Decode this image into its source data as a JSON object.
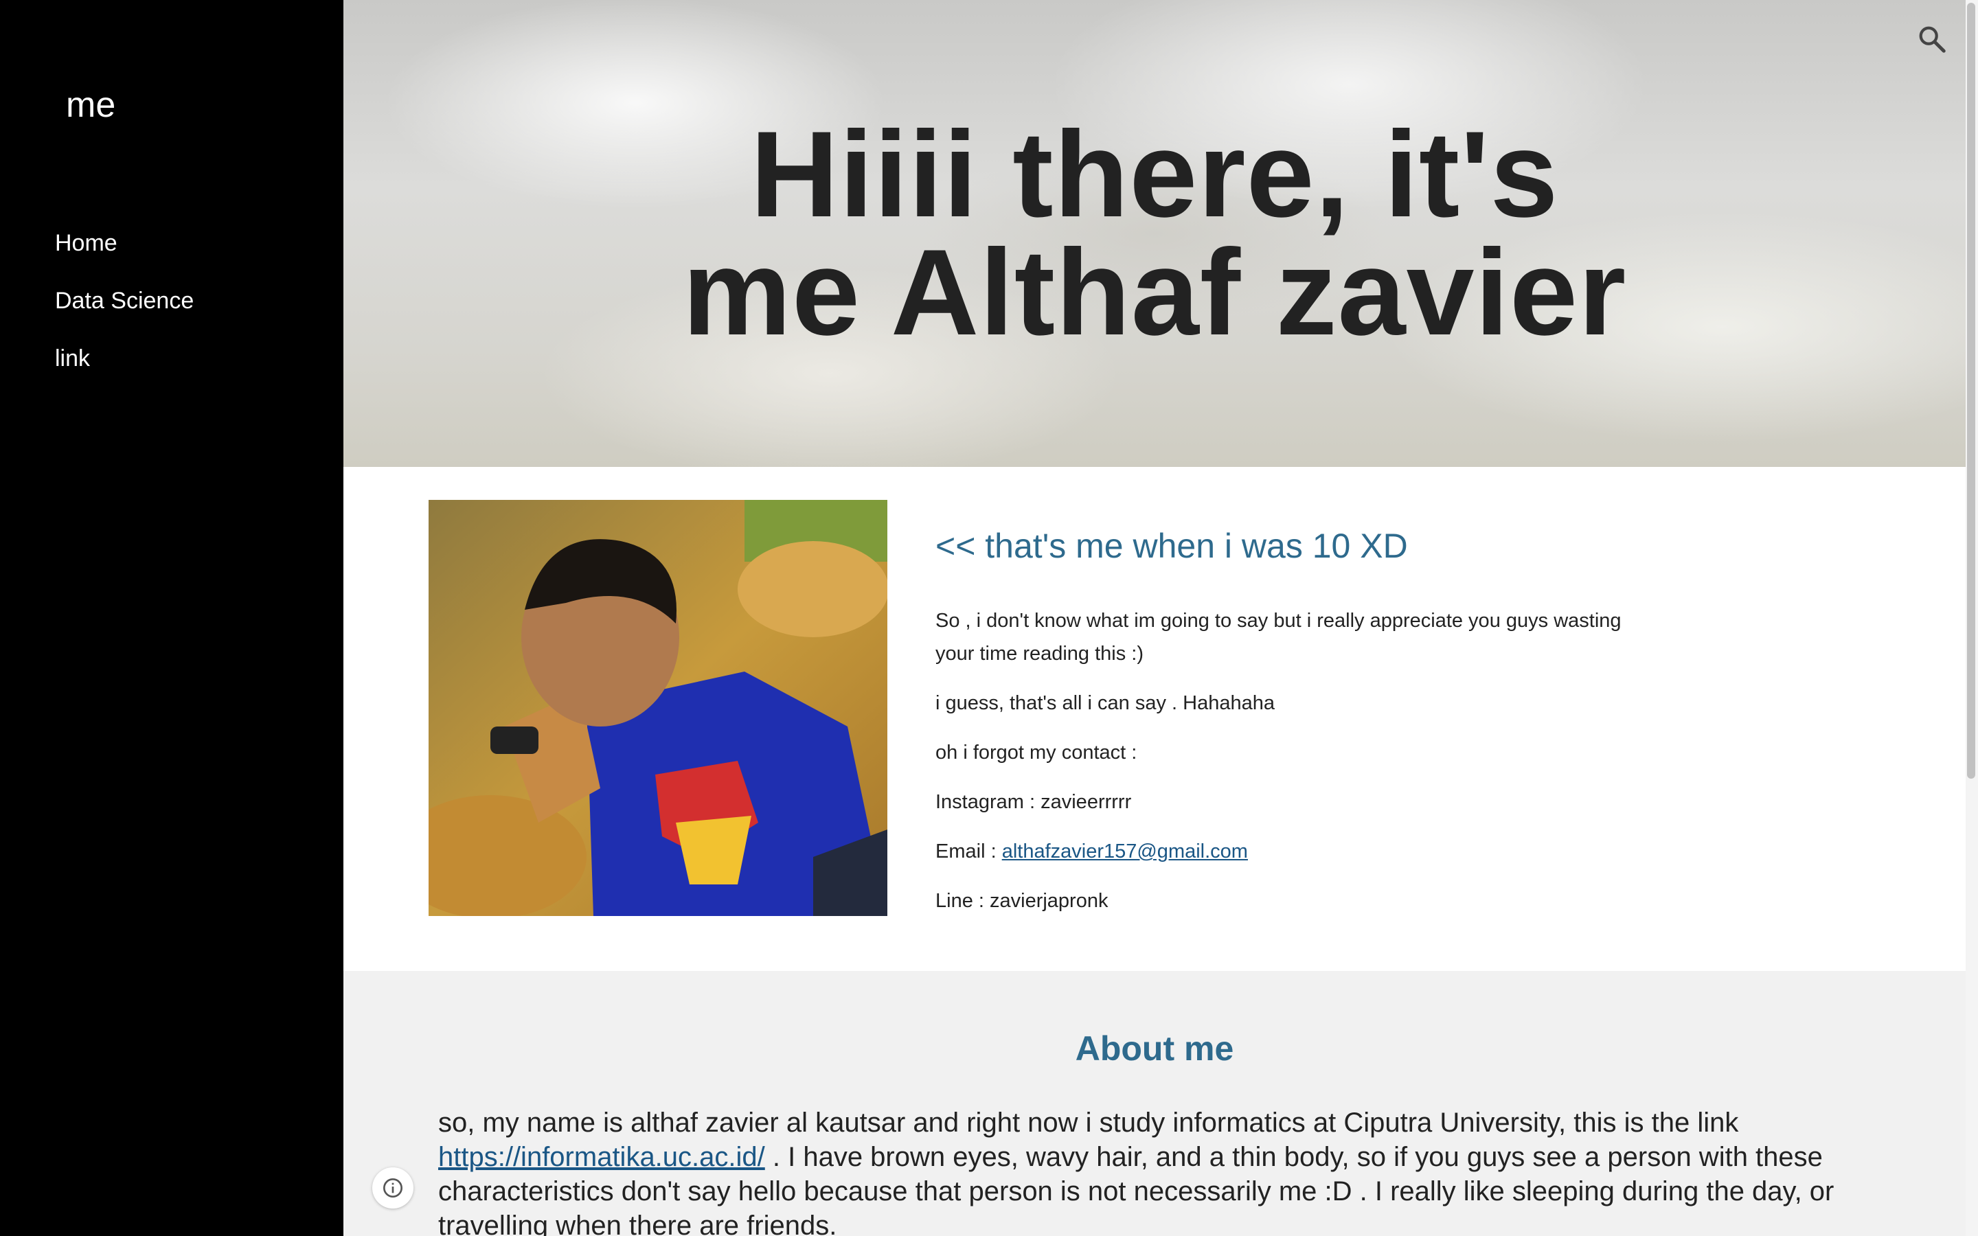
{
  "sidebar": {
    "site_title": "me",
    "nav": [
      "Home",
      "Data Science",
      "link"
    ]
  },
  "hero": {
    "title_line1": "Hiiii there, it's",
    "title_line2": "me Althaf zavier",
    "search_icon": "search-icon"
  },
  "intro": {
    "photo_icon": "photo-of-boy",
    "caption": "<< that's me when i was 10 XD",
    "paragraphs": [
      "So , i don't know what im going to say but i really appreciate you guys wasting your time reading this :)",
      "i guess, that's all i can say . Hahahaha",
      "oh i forgot my contact :",
      "Instagram : zavieerrrrr"
    ],
    "email_label": "Email : ",
    "email_link": "althafzavier157@gmail.com",
    "line_text": "Line : zavierjapronk"
  },
  "about": {
    "heading": "About me",
    "text_before_link": "so, my name is althaf zavier al kautsar and right now i study informatics at Ciputra University, this is the link ",
    "link": "https://informatika.uc.ac.id/",
    "text_after_link": " . I have brown eyes, wavy hair, and a thin body, so if you guys see a person with these characteristics don't say hello because that person is not necessarily me :D . I really like sleeping during the day, or travelling when there are friends."
  },
  "colors": {
    "sidebar_bg": "#000000",
    "accent": "#2e6a8d",
    "link": "#1a5685",
    "about_bg": "#f1f1f1"
  },
  "info_icon": "info-icon"
}
